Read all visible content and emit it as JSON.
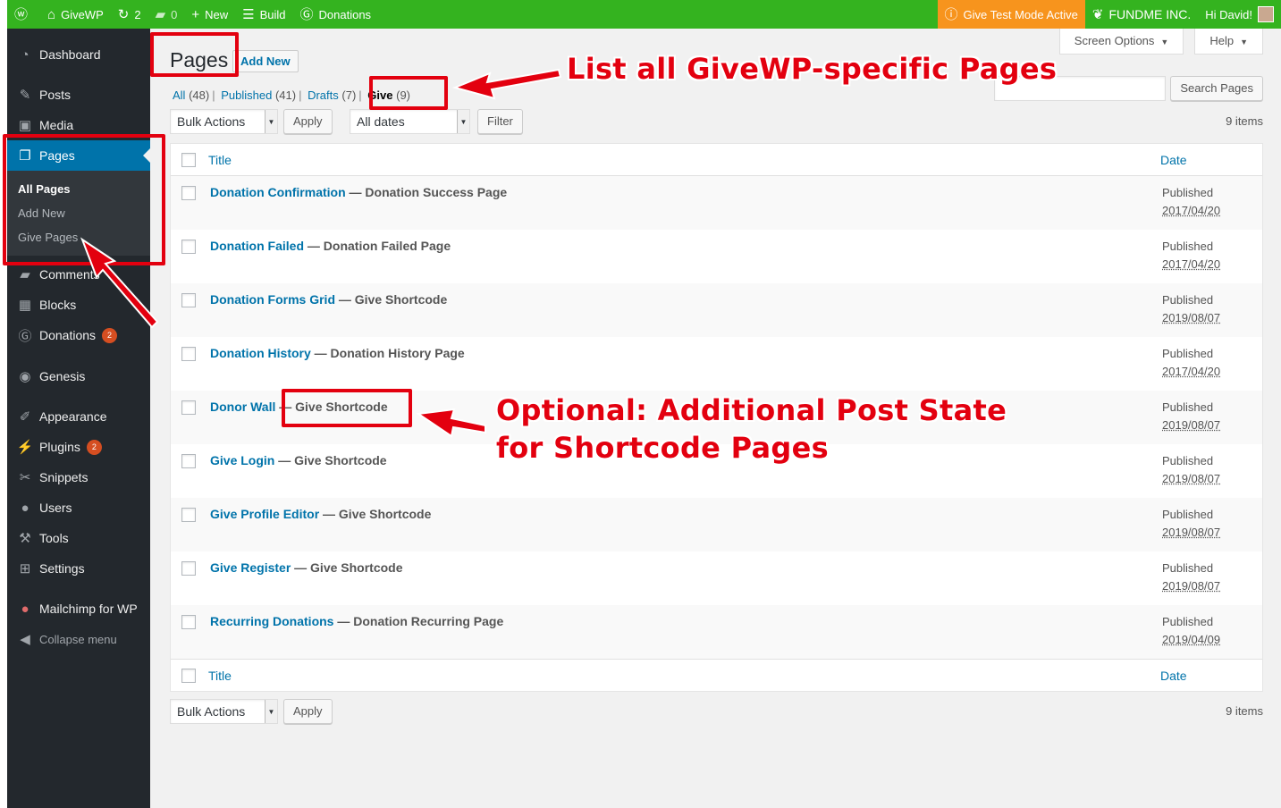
{
  "adminbar": {
    "site_name": "GiveWP",
    "updates_count": "2",
    "comments_count": "0",
    "new_label": "New",
    "build_label": "Build",
    "donations_label": "Donations",
    "test_mode_label": "Give Test Mode Active",
    "org_label": "FUNDME INC.",
    "greeting": "Hi David!"
  },
  "sidebar": {
    "items": [
      {
        "label": "Dashboard",
        "icon": "dashboard-icon"
      },
      {
        "label": "Posts",
        "icon": "pin-icon"
      },
      {
        "label": "Media",
        "icon": "media-icon"
      },
      {
        "label": "Pages",
        "icon": "pages-icon"
      },
      {
        "label": "Comments",
        "icon": "comments-icon"
      },
      {
        "label": "Blocks",
        "icon": "blocks-icon"
      },
      {
        "label": "Donations",
        "icon": "give-icon",
        "badge": "2"
      },
      {
        "label": "Genesis",
        "icon": "genesis-icon"
      },
      {
        "label": "Appearance",
        "icon": "brush-icon"
      },
      {
        "label": "Plugins",
        "icon": "plugin-icon",
        "badge": "2"
      },
      {
        "label": "Snippets",
        "icon": "scissors-icon"
      },
      {
        "label": "Users",
        "icon": "user-icon"
      },
      {
        "label": "Tools",
        "icon": "wrench-icon"
      },
      {
        "label": "Settings",
        "icon": "settings-icon"
      },
      {
        "label": "Mailchimp for WP",
        "icon": "mailchimp-icon"
      },
      {
        "label": "Collapse menu",
        "icon": "collapse-icon"
      }
    ],
    "submenu": [
      "All Pages",
      "Add New",
      "Give Pages"
    ]
  },
  "header": {
    "screen_options": "Screen Options",
    "help": "Help",
    "title": "Pages",
    "add_new": "Add New"
  },
  "views": {
    "all": {
      "label": "All",
      "count": "(48)"
    },
    "published": {
      "label": "Published",
      "count": "(41)"
    },
    "drafts": {
      "label": "Drafts",
      "count": "(7)"
    },
    "give": {
      "label": "Give",
      "count": "(9)"
    }
  },
  "search": {
    "button": "Search Pages",
    "placeholder": ""
  },
  "tablenav": {
    "bulk_actions": "Bulk Actions",
    "apply": "Apply",
    "all_dates": "All dates",
    "filter": "Filter",
    "items": "9 items"
  },
  "table": {
    "columns": {
      "title": "Title",
      "date": "Date"
    },
    "rows": [
      {
        "title": "Donation Confirmation",
        "state": "— Donation Success Page",
        "status": "Published",
        "date": "2017/04/20"
      },
      {
        "title": "Donation Failed",
        "state": "— Donation Failed Page",
        "status": "Published",
        "date": "2017/04/20"
      },
      {
        "title": "Donation Forms Grid",
        "state": "— Give Shortcode",
        "status": "Published",
        "date": "2019/08/07"
      },
      {
        "title": "Donation History",
        "state": "— Donation History Page",
        "status": "Published",
        "date": "2017/04/20"
      },
      {
        "title": "Donor Wall",
        "state": "— Give Shortcode",
        "status": "Published",
        "date": "2019/08/07"
      },
      {
        "title": "Give Login",
        "state": "— Give Shortcode",
        "status": "Published",
        "date": "2019/08/07"
      },
      {
        "title": "Give Profile Editor",
        "state": "— Give Shortcode",
        "status": "Published",
        "date": "2019/08/07"
      },
      {
        "title": "Give Register",
        "state": "— Give Shortcode",
        "status": "Published",
        "date": "2019/08/07"
      },
      {
        "title": "Recurring Donations",
        "state": "— Donation Recurring Page",
        "status": "Published",
        "date": "2019/04/09"
      }
    ]
  },
  "annotations": {
    "top": "List all GiveWP-specific Pages",
    "middle_line1": "Optional: Additional Post State",
    "middle_line2": "for Shortcode Pages",
    "highlight_color": "#e3000f"
  },
  "colors": {
    "adminbar": "#34b31f",
    "test_mode": "#f7941d",
    "sidebar": "#23282d",
    "accent": "#0073aa"
  }
}
